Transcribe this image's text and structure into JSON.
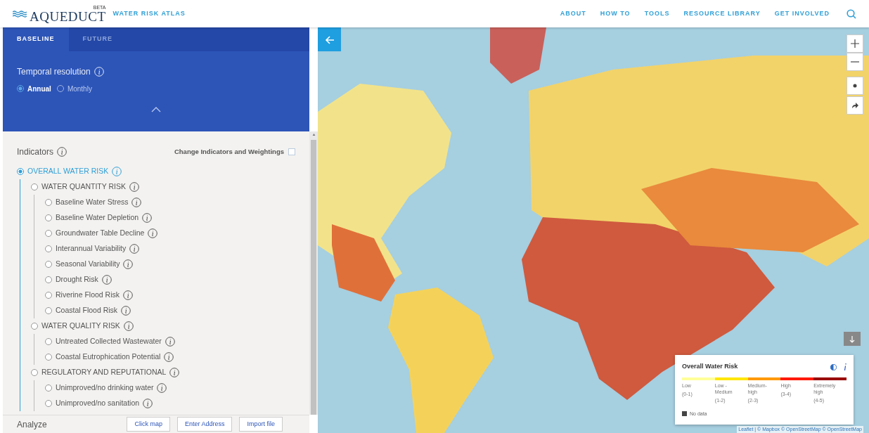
{
  "header": {
    "logo": "AQUEDUCT",
    "logo_badge": "BETA",
    "subtitle": "WATER RISK ATLAS",
    "nav": [
      "ABOUT",
      "HOW TO",
      "TOOLS",
      "RESOURCE LIBRARY",
      "GET INVOLVED"
    ]
  },
  "tabs": [
    {
      "label": "BASELINE",
      "selected": true
    },
    {
      "label": "FUTURE",
      "selected": false
    }
  ],
  "temporal": {
    "title": "Temporal resolution",
    "options": [
      {
        "label": "Annual",
        "selected": true
      },
      {
        "label": "Monthly",
        "selected": false
      }
    ]
  },
  "indicators": {
    "title": "Indicators",
    "change_label": "Change Indicators and Weightings",
    "change_checked": false,
    "tree": [
      {
        "label": "OVERALL WATER RISK",
        "selected": true,
        "children": [
          {
            "label": "WATER QUANTITY RISK",
            "selected": false,
            "children": [
              {
                "label": "Baseline Water Stress",
                "selected": false
              },
              {
                "label": "Baseline Water Depletion",
                "selected": false
              },
              {
                "label": "Groundwater Table Decline",
                "selected": false
              },
              {
                "label": "Interannual Variability",
                "selected": false
              },
              {
                "label": "Seasonal Variability",
                "selected": false
              },
              {
                "label": "Drought Risk",
                "selected": false
              },
              {
                "label": "Riverine Flood Risk",
                "selected": false
              },
              {
                "label": "Coastal Flood Risk",
                "selected": false
              }
            ]
          },
          {
            "label": "WATER QUALITY RISK",
            "selected": false,
            "children": [
              {
                "label": "Untreated Collected Wastewater",
                "selected": false
              },
              {
                "label": "Coastal Eutrophication Potential",
                "selected": false
              }
            ]
          },
          {
            "label": "REGULATORY AND REPUTATIONAL",
            "selected": false,
            "children": [
              {
                "label": "Unimproved/no drinking water",
                "selected": false
              },
              {
                "label": "Unimproved/no sanitation",
                "selected": false
              }
            ]
          }
        ]
      }
    ]
  },
  "analyze": {
    "title": "Analyze",
    "buttons": [
      "Click map",
      "Enter Address",
      "Import file"
    ]
  },
  "legend": {
    "title": "Overall Water Risk",
    "classes": [
      {
        "label": "Low",
        "range": "(0-1)",
        "color": "#ffff99"
      },
      {
        "label": "Low - Medium",
        "range": "(1-2)",
        "color": "#ffe600"
      },
      {
        "label": "Medium-high",
        "range": "(2-3)",
        "color": "#ff9900"
      },
      {
        "label": "High",
        "range": "(3-4)",
        "color": "#ff1900"
      },
      {
        "label": "Extremely high",
        "range": "(4-5)",
        "color": "#990000"
      }
    ],
    "no_data": "No data"
  },
  "attribution": "Leaflet | © Mapbox © OpenStreetMap © OpenStreetMap"
}
